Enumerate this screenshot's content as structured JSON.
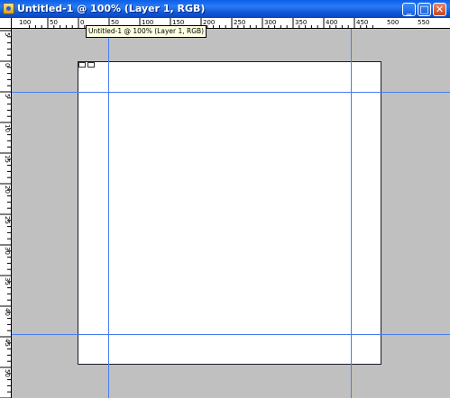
{
  "window": {
    "title": "Untitled-1 @ 100% (Layer 1, RGB)",
    "buttons": {
      "minimize": "_",
      "maximize": "□",
      "close": "✕"
    }
  },
  "ruler_top": {
    "labels": [
      "100",
      "50",
      "0",
      "50",
      "100",
      "150",
      "200",
      "250",
      "300",
      "350",
      "400",
      "450",
      "500",
      "550"
    ]
  },
  "ruler_left": {
    "labels": [
      "5",
      "0",
      "5",
      "10",
      "15",
      "20",
      "25",
      "30",
      "35",
      "40",
      "45",
      "50"
    ]
  },
  "tooltip": {
    "text": "Untitled-1 @ 100% (Layer 1, RGB)"
  },
  "document": {
    "zoom": "100%",
    "layer": "Layer 1",
    "mode": "RGB"
  },
  "colors": {
    "titlebar": "#1057d6",
    "guide": "#4a7cf0",
    "canvas_bg": "#c0c0c0",
    "document_bg": "#ffffff"
  }
}
